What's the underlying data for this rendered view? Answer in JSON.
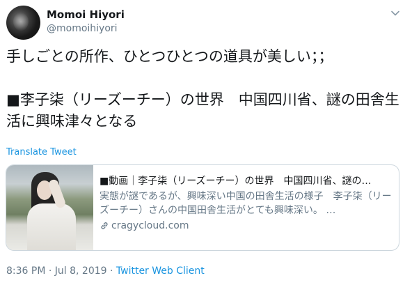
{
  "tweet": {
    "author_name": "Momoi Hiyori",
    "author_handle": "@momoihiyori",
    "text": "手しごとの所作、ひとつひとつの道具が美しい；；\n\n■李子柒（リーズーチー）の世界　中国四川省、謎の田舎生活に興味津々となる",
    "translate_label": "Translate Tweet",
    "timestamp": "8:36 PM · Jul 8, 2019 · ",
    "client": "Twitter Web Client"
  },
  "card": {
    "title": "■動画｜李子柒（リーズーチー）の世界　中国四川省、謎の…",
    "description": "実態が謎であるが、興味深い中国の田舎生活の様子　李子柒（リーズーチー）さんの中国田舎生活がとても興味深い。 …",
    "domain": "cragycloud.com"
  },
  "icons": {
    "menu": "chevron-down-icon",
    "link": "link-icon"
  },
  "colors": {
    "link": "#1b95e0",
    "secondary_text": "#657786",
    "border": "#ccd6dd"
  }
}
